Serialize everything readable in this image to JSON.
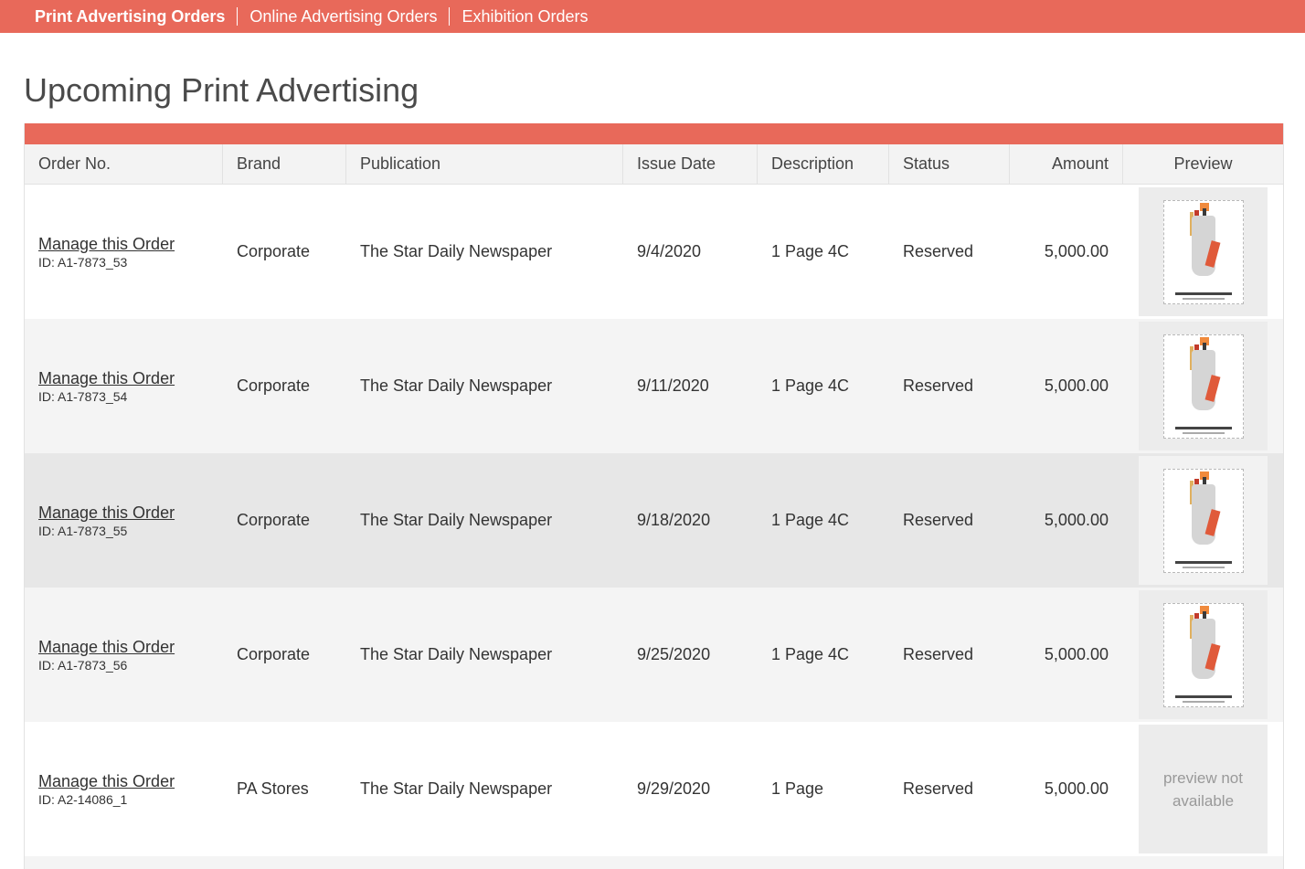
{
  "nav": {
    "items": [
      {
        "label": "Print Advertising Orders"
      },
      {
        "label": "Online Advertising Orders"
      },
      {
        "label": "Exhibition Orders"
      }
    ]
  },
  "page": {
    "title": "Upcoming Print Advertising"
  },
  "table": {
    "headers": {
      "order_no": "Order No.",
      "brand": "Brand",
      "publication": "Publication",
      "issue_date": "Issue Date",
      "description": "Description",
      "status": "Status",
      "amount": "Amount",
      "preview": "Preview"
    },
    "rows": [
      {
        "link": "Manage this Order",
        "id": "ID: A1-7873_53",
        "brand": "Corporate",
        "publication": "The Star Daily Newspaper",
        "issue_date": "9/4/2020",
        "description": "1 Page 4C",
        "status": "Reserved",
        "amount": "5,000.00"
      },
      {
        "link": "Manage this Order",
        "id": "ID: A1-7873_54",
        "brand": "Corporate",
        "publication": "The Star Daily Newspaper",
        "issue_date": "9/11/2020",
        "description": "1 Page 4C",
        "status": "Reserved",
        "amount": "5,000.00"
      },
      {
        "link": "Manage this Order",
        "id": "ID: A1-7873_55",
        "brand": "Corporate",
        "publication": "The Star Daily Newspaper",
        "issue_date": "9/18/2020",
        "description": "1 Page 4C",
        "status": "Reserved",
        "amount": "5,000.00"
      },
      {
        "link": "Manage this Order",
        "id": "ID: A1-7873_56",
        "brand": "Corporate",
        "publication": "The Star Daily Newspaper",
        "issue_date": "9/25/2020",
        "description": "1 Page 4C",
        "status": "Reserved",
        "amount": "5,000.00"
      },
      {
        "link": "Manage this Order",
        "id": "ID: A2-14086_1",
        "brand": "PA Stores",
        "publication": "The Star Daily Newspaper",
        "issue_date": "9/29/2020",
        "description": "1 Page",
        "status": "Reserved",
        "amount": "5,000.00",
        "preview_text_1": "preview not",
        "preview_text_2": "available"
      }
    ]
  },
  "colors": {
    "accent": "#e8695a"
  }
}
